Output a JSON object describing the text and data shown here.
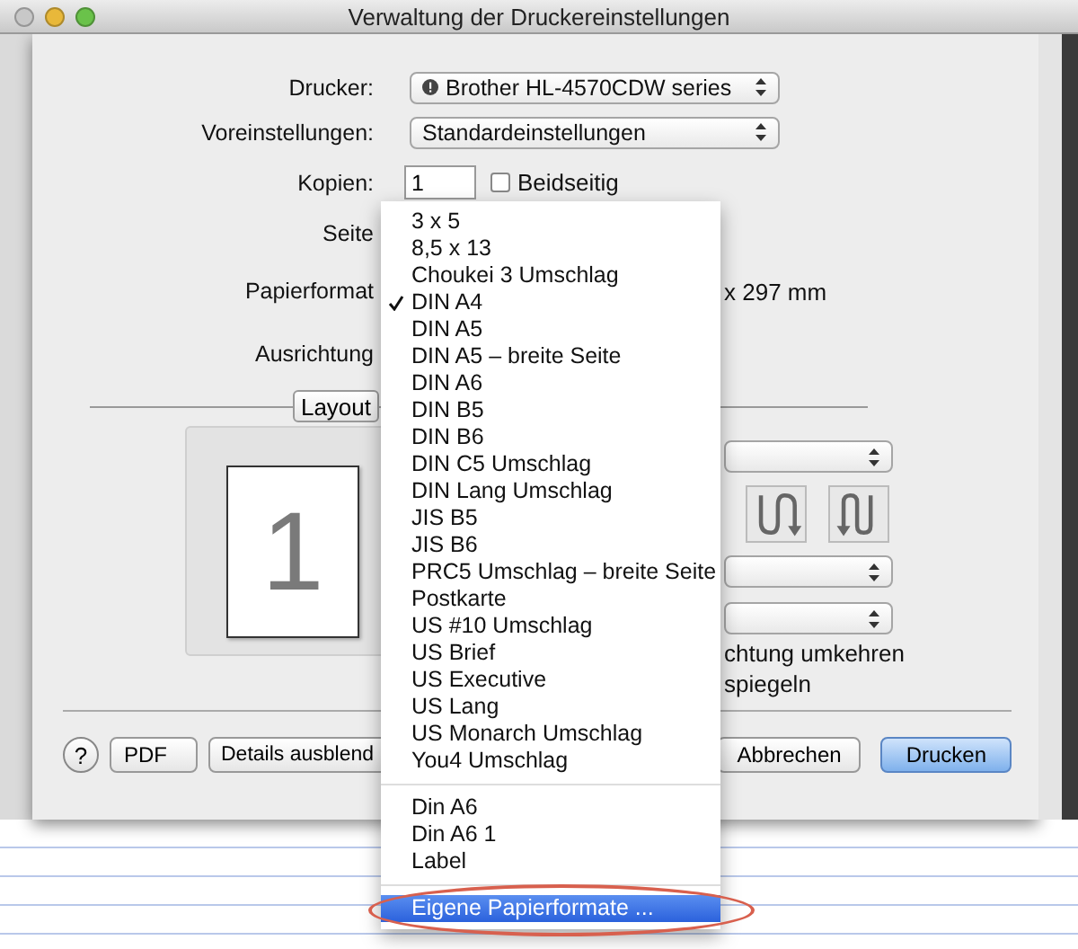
{
  "window": {
    "title": "Verwaltung der Druckereinstellungen",
    "controls": [
      {
        "kind": "close",
        "disabled": true
      },
      {
        "kind": "minimize",
        "disabled": false
      },
      {
        "kind": "zoom",
        "disabled": false
      }
    ]
  },
  "form": {
    "printer": {
      "label": "Drucker:",
      "value": "Brother HL-4570CDW series"
    },
    "presets": {
      "label": "Voreinstellungen:",
      "value": "Standardeinstellungen"
    },
    "copies": {
      "label": "Kopien:",
      "value": "1"
    },
    "duplex": {
      "label": "Beidseitig",
      "checked": false
    },
    "pages_label": "Seite",
    "paper_size_label": "Papierformat",
    "paper_size_dims": "x 297 mm",
    "orientation_label": "Ausrichtung"
  },
  "section": {
    "label": "Layout",
    "preview_page": "1",
    "direction_buttons": [
      {
        "kind": "s"
      },
      {
        "kind": "n"
      }
    ],
    "texts": [
      "chtung umkehren",
      "spiegeln"
    ]
  },
  "buttons": [
    {
      "kind": "help",
      "label": "?"
    },
    {
      "kind": "menu",
      "label": "PDF"
    },
    {
      "kind": "plain",
      "label": "Details ausblend"
    },
    {
      "kind": "plain",
      "label": "Abbrechen"
    },
    {
      "kind": "default",
      "label": "Drucken"
    }
  ],
  "paper_menu": {
    "groups": [
      [
        {
          "label": "3 x 5",
          "checked": false,
          "selected": false
        },
        {
          "label": "8,5 x 13",
          "checked": false,
          "selected": false
        },
        {
          "label": "Choukei 3 Umschlag",
          "checked": false,
          "selected": false
        },
        {
          "label": "DIN A4",
          "checked": true,
          "selected": false
        },
        {
          "label": "DIN A5",
          "checked": false,
          "selected": false
        },
        {
          "label": "DIN A5 – breite Seite",
          "checked": false,
          "selected": false
        },
        {
          "label": "DIN A6",
          "checked": false,
          "selected": false
        },
        {
          "label": "DIN B5",
          "checked": false,
          "selected": false
        },
        {
          "label": "DIN B6",
          "checked": false,
          "selected": false
        },
        {
          "label": "DIN C5 Umschlag",
          "checked": false,
          "selected": false
        },
        {
          "label": "DIN Lang Umschlag",
          "checked": false,
          "selected": false
        },
        {
          "label": "JIS B5",
          "checked": false,
          "selected": false
        },
        {
          "label": "JIS B6",
          "checked": false,
          "selected": false
        },
        {
          "label": "PRC5 Umschlag – breite Seite",
          "checked": false,
          "selected": false
        },
        {
          "label": "Postkarte",
          "checked": false,
          "selected": false
        },
        {
          "label": "US #10 Umschlag",
          "checked": false,
          "selected": false
        },
        {
          "label": "US Brief",
          "checked": false,
          "selected": false
        },
        {
          "label": "US Executive",
          "checked": false,
          "selected": false
        },
        {
          "label": "US Lang",
          "checked": false,
          "selected": false
        },
        {
          "label": "US Monarch Umschlag",
          "checked": false,
          "selected": false
        },
        {
          "label": "You4 Umschlag",
          "checked": false,
          "selected": false
        }
      ],
      [
        {
          "label": "Din A6",
          "checked": false,
          "selected": false
        },
        {
          "label": "Din A6 1",
          "checked": false,
          "selected": false
        },
        {
          "label": "Label",
          "checked": false,
          "selected": false
        }
      ],
      [
        {
          "label": "Eigene Papierformate ...",
          "checked": false,
          "selected": true
        }
      ]
    ]
  }
}
